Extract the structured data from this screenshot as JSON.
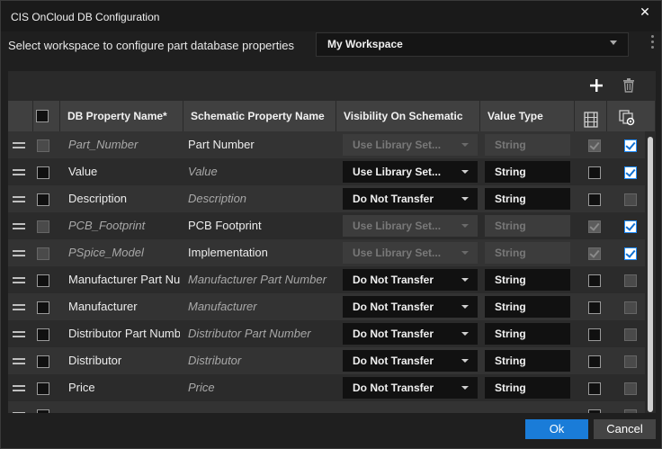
{
  "window": {
    "title": "CIS OnCloud DB Configuration"
  },
  "workspace": {
    "label": "Select workspace to configure part database properties",
    "selected": "My Workspace"
  },
  "toolbar": {
    "add_icon": "plus-icon",
    "delete_icon": "trash-icon"
  },
  "table": {
    "headers": {
      "db_property": "DB Property Name*",
      "schematic_property": "Schematic Property Name",
      "visibility": "Visibility On Schematic",
      "value_type": "Value Type",
      "col_icon1": "table-columns-icon",
      "col_icon2": "copy-settings-icon"
    },
    "rows": [
      {
        "db": "Part_Number",
        "db_italic": true,
        "sch": "Part Number",
        "sch_italic": false,
        "vis": "Use Library Set...",
        "vis_disabled": true,
        "type": "String",
        "type_disabled": true,
        "c1": "dimchecked",
        "c2": "checked",
        "sel": "dim"
      },
      {
        "db": "Value",
        "db_italic": false,
        "sch": "Value",
        "sch_italic": true,
        "vis": "Use Library Set...",
        "vis_disabled": false,
        "type": "String",
        "type_disabled": false,
        "c1": "unchecked",
        "c2": "checked",
        "sel": "unchecked"
      },
      {
        "db": "Description",
        "db_italic": false,
        "sch": "Description",
        "sch_italic": true,
        "vis": "Do Not Transfer",
        "vis_disabled": false,
        "type": "String",
        "type_disabled": false,
        "c1": "unchecked",
        "c2": "dim",
        "sel": "unchecked"
      },
      {
        "db": "PCB_Footprint",
        "db_italic": true,
        "sch": "PCB Footprint",
        "sch_italic": false,
        "vis": "Use Library Set...",
        "vis_disabled": true,
        "type": "String",
        "type_disabled": true,
        "c1": "dimchecked",
        "c2": "checked",
        "sel": "dim"
      },
      {
        "db": "PSpice_Model",
        "db_italic": true,
        "sch": "Implementation",
        "sch_italic": false,
        "vis": "Use Library Set...",
        "vis_disabled": true,
        "type": "String",
        "type_disabled": true,
        "c1": "dimchecked",
        "c2": "checked",
        "sel": "dim"
      },
      {
        "db": "Manufacturer Part Number",
        "db_italic": false,
        "sch": "Manufacturer Part Number",
        "sch_italic": true,
        "vis": "Do Not Transfer",
        "vis_disabled": false,
        "type": "String",
        "type_disabled": false,
        "c1": "unchecked",
        "c2": "dim",
        "sel": "unchecked"
      },
      {
        "db": "Manufacturer",
        "db_italic": false,
        "sch": "Manufacturer",
        "sch_italic": true,
        "vis": "Do Not Transfer",
        "vis_disabled": false,
        "type": "String",
        "type_disabled": false,
        "c1": "unchecked",
        "c2": "dim",
        "sel": "unchecked"
      },
      {
        "db": "Distributor Part Number",
        "db_italic": false,
        "sch": "Distributor Part Number",
        "sch_italic": true,
        "vis": "Do Not Transfer",
        "vis_disabled": false,
        "type": "String",
        "type_disabled": false,
        "c1": "unchecked",
        "c2": "dim",
        "sel": "unchecked"
      },
      {
        "db": "Distributor",
        "db_italic": false,
        "sch": "Distributor",
        "sch_italic": true,
        "vis": "Do Not Transfer",
        "vis_disabled": false,
        "type": "String",
        "type_disabled": false,
        "c1": "unchecked",
        "c2": "dim",
        "sel": "unchecked"
      },
      {
        "db": "Price",
        "db_italic": false,
        "sch": "Price",
        "sch_italic": true,
        "vis": "Do Not Transfer",
        "vis_disabled": false,
        "type": "String",
        "type_disabled": false,
        "c1": "unchecked",
        "c2": "dim",
        "sel": "unchecked"
      },
      {
        "db": "",
        "db_italic": false,
        "sch": "",
        "sch_italic": false,
        "vis": "",
        "vis_disabled": false,
        "type": "",
        "type_disabled": false,
        "c1": "unchecked",
        "c2": "dim",
        "sel": "unchecked"
      }
    ]
  },
  "footer": {
    "ok_label": "Ok",
    "cancel_label": "Cancel"
  }
}
